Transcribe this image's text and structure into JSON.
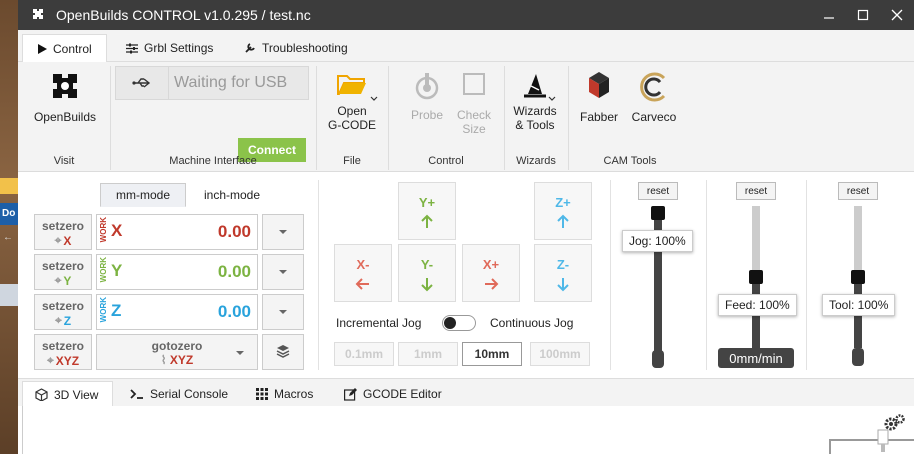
{
  "window": {
    "title": "OpenBuilds CONTROL v1.0.295 / test.nc"
  },
  "ribbon_tabs": [
    {
      "label": "Control",
      "icon": "play-icon"
    },
    {
      "label": "Grbl Settings",
      "icon": "sliders-icon"
    },
    {
      "label": "Troubleshooting",
      "icon": "wrench-icon"
    }
  ],
  "ribbon": {
    "visit": {
      "button": "OpenBuilds",
      "group": "Visit"
    },
    "machine": {
      "status": "Waiting for USB",
      "connect": "Connect",
      "group": "Machine Interface"
    },
    "file": {
      "open_line1": "Open",
      "open_line2": "G-CODE",
      "group": "File"
    },
    "control": {
      "probe": "Probe",
      "check_line1": "Check",
      "check_line2": "Size",
      "group": "Control"
    },
    "wizards": {
      "line1": "Wizards",
      "line2": "& Tools",
      "group": "Wizards"
    },
    "cam": {
      "fabber": "Fabber",
      "carveco": "Carveco",
      "group": "CAM Tools"
    }
  },
  "modes": {
    "mm": "mm-mode",
    "inch": "inch-mode"
  },
  "dro": {
    "setzero_label": "setzero",
    "work_label": "WORK",
    "rows": [
      {
        "axis": "X",
        "value": "0.00"
      },
      {
        "axis": "Y",
        "value": "0.00"
      },
      {
        "axis": "Z",
        "value": "0.00"
      }
    ],
    "xyz_label": "XYZ",
    "gotozero_label": "gotozero"
  },
  "jog": {
    "y_plus": "Y+",
    "y_minus": "Y-",
    "x_plus": "X+",
    "x_minus": "X-",
    "z_plus": "Z+",
    "z_minus": "Z-",
    "incremental": "Incremental Jog",
    "continuous": "Continuous Jog",
    "steps": [
      "0.1mm",
      "1mm",
      "10mm",
      "100mm"
    ],
    "active_step": "10mm"
  },
  "overrides": {
    "reset": "reset",
    "jog": {
      "label": "Jog: 100%",
      "value_pct": 100
    },
    "feed": {
      "label": "Feed: 100%",
      "value_pct": 100,
      "rate": "0mm/min"
    },
    "tool": {
      "label": "Tool: 100%",
      "value_pct": 100
    }
  },
  "bottom_tabs": [
    {
      "label": "3D View",
      "icon": "cube-icon"
    },
    {
      "label": "Serial Console",
      "icon": "terminal-icon"
    },
    {
      "label": "Macros",
      "icon": "grid-icon"
    },
    {
      "label": "GCODE Editor",
      "icon": "edit-icon"
    }
  ],
  "desktop": {
    "item_label": "Do"
  },
  "colors": {
    "x": "#c0392b",
    "y": "#7cb342",
    "z": "#29a3dc",
    "connect": "#8bc34a",
    "titlebar": "#3c3c3c"
  }
}
